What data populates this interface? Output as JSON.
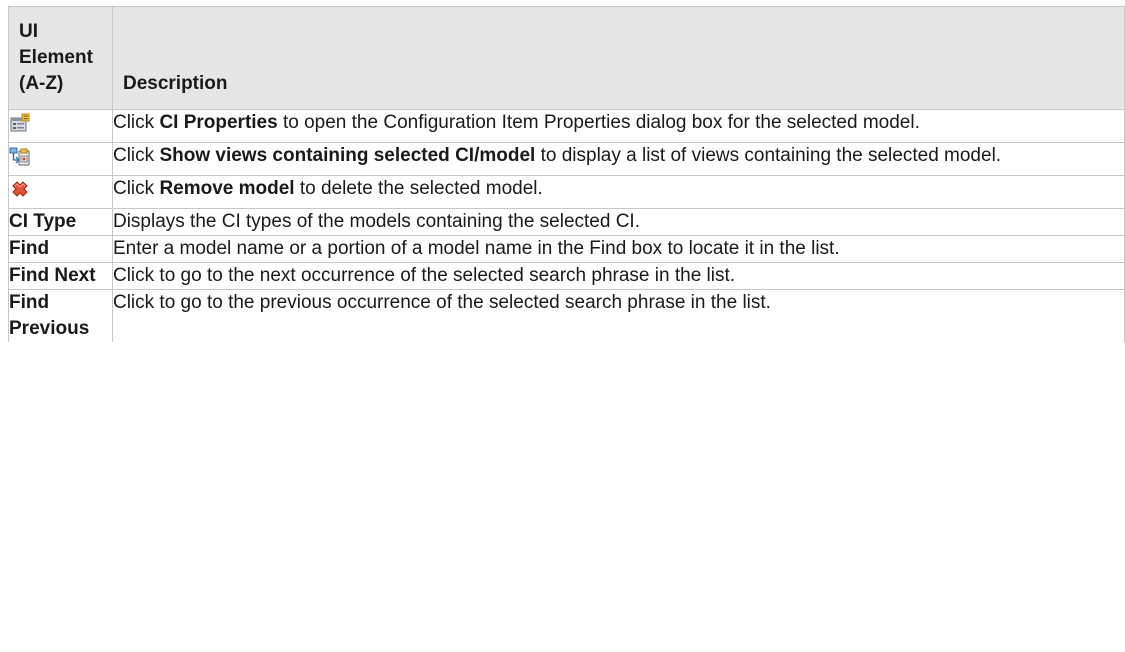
{
  "header": {
    "col1": "UI Element (A-Z)",
    "col2": "Description"
  },
  "rows": [
    {
      "icon": "ci-properties-icon",
      "element": "",
      "pre": "Click ",
      "bold": "CI Properties",
      "post": " to open the Configuration Item Properties dialog box for the selected model."
    },
    {
      "icon": "show-views-icon",
      "element": "",
      "pre": "Click ",
      "bold": "Show views containing selected CI/model",
      "post": " to display a list of views containing the selected model."
    },
    {
      "icon": "remove-model-icon",
      "element": "",
      "pre": "Click ",
      "bold": "Remove model",
      "post": " to delete the selected model."
    },
    {
      "icon": "",
      "element": "CI Type",
      "pre": "Displays the CI types of the models containing the selected CI.",
      "bold": "",
      "post": ""
    },
    {
      "icon": "",
      "element": "Find",
      "pre": "Enter a model name or a portion of a model name in the Find box to locate it in the list.",
      "bold": "",
      "post": ""
    },
    {
      "icon": "",
      "element": "Find Next",
      "pre": "Click to go to the next occurrence of the selected search phrase in the list.",
      "bold": "",
      "post": ""
    },
    {
      "icon": "",
      "element": "Find Previous",
      "pre": "Click to go to the previous occurrence of the selected search phrase in the list.",
      "bold": "",
      "post": ""
    }
  ]
}
